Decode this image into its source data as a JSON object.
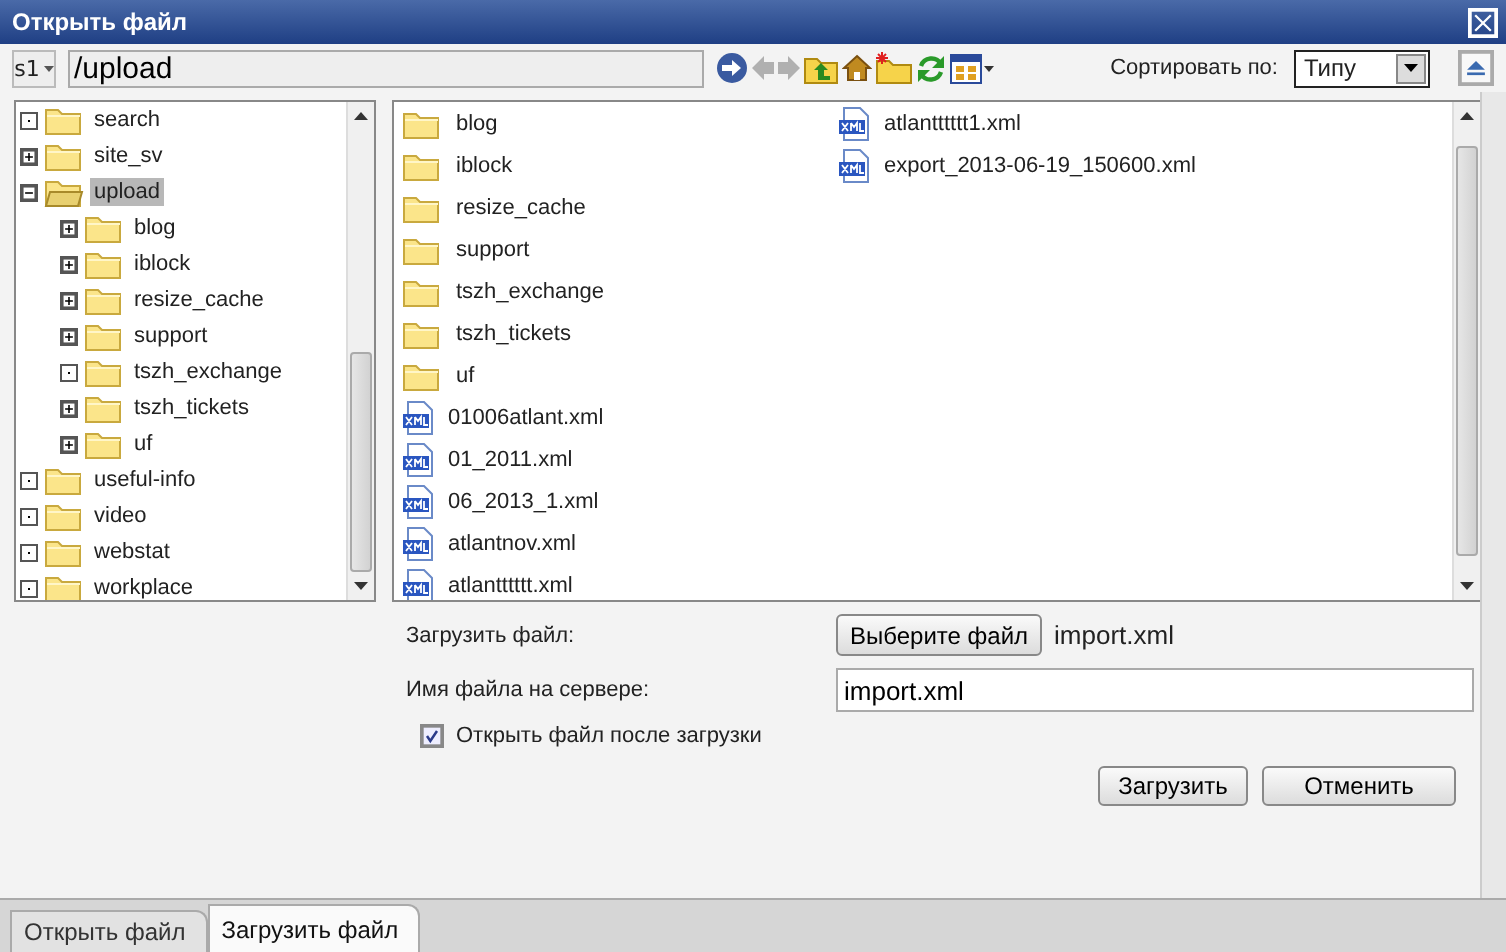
{
  "window": {
    "title": "Открыть файл"
  },
  "toolbar": {
    "site": "s1",
    "path": "/upload",
    "sort_label": "Сортировать по:",
    "sort_value": "Типу"
  },
  "tree": [
    {
      "label": "search",
      "kind": "leaf",
      "selected": false
    },
    {
      "label": "site_sv",
      "kind": "branch",
      "expanded": false,
      "selected": false
    },
    {
      "label": "upload",
      "kind": "branch",
      "expanded": true,
      "selected": true,
      "children": [
        {
          "label": "blog",
          "kind": "branch",
          "expanded": false,
          "selected": false
        },
        {
          "label": "iblock",
          "kind": "branch",
          "expanded": false,
          "selected": false
        },
        {
          "label": "resize_cache",
          "kind": "branch",
          "expanded": false,
          "selected": false
        },
        {
          "label": "support",
          "kind": "branch",
          "expanded": false,
          "selected": false
        },
        {
          "label": "tszh_exchange",
          "kind": "leaf",
          "selected": false
        },
        {
          "label": "tszh_tickets",
          "kind": "branch",
          "expanded": false,
          "selected": false
        },
        {
          "label": "uf",
          "kind": "branch",
          "expanded": false,
          "selected": false
        }
      ]
    },
    {
      "label": "useful-info",
      "kind": "leaf",
      "selected": false
    },
    {
      "label": "video",
      "kind": "leaf",
      "selected": false
    },
    {
      "label": "webstat",
      "kind": "leaf",
      "selected": false
    },
    {
      "label": "workplace",
      "kind": "leaf",
      "selected": false
    }
  ],
  "files": [
    {
      "name": "blog",
      "kind": "folder"
    },
    {
      "name": "iblock",
      "kind": "folder"
    },
    {
      "name": "resize_cache",
      "kind": "folder"
    },
    {
      "name": "support",
      "kind": "folder"
    },
    {
      "name": "tszh_exchange",
      "kind": "folder"
    },
    {
      "name": "tszh_tickets",
      "kind": "folder"
    },
    {
      "name": "uf",
      "kind": "folder"
    },
    {
      "name": "01006atlant.xml",
      "kind": "xml"
    },
    {
      "name": "01_2011.xml",
      "kind": "xml"
    },
    {
      "name": "06_2013_1.xml",
      "kind": "xml"
    },
    {
      "name": "atlantnov.xml",
      "kind": "xml"
    },
    {
      "name": "atlantttttt.xml",
      "kind": "xml"
    },
    {
      "name": "atlantttttt1.xml",
      "kind": "xml"
    },
    {
      "name": "export_2013-06-19_150600.xml",
      "kind": "xml"
    }
  ],
  "form": {
    "upload_label": "Загрузить файл:",
    "choose_button": "Выберите файл",
    "chosen_file": "import.xml",
    "server_name_label": "Имя файла на сервере:",
    "server_name_value": "import.xml",
    "open_after": {
      "label": "Открыть файл после загрузки",
      "checked": true
    },
    "buttons": [
      "Загрузить",
      "Отменить"
    ]
  },
  "tabs": [
    {
      "label": "Открыть файл",
      "selected": false
    },
    {
      "label": "Загрузить файл",
      "selected": true
    }
  ]
}
